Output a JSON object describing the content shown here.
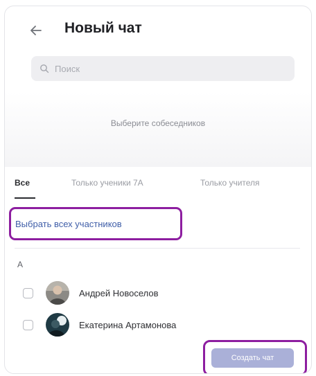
{
  "header": {
    "title": "Новый чат",
    "back_icon": "arrow-left-icon"
  },
  "search": {
    "placeholder": "Поиск",
    "value": "",
    "icon": "search-icon"
  },
  "selected": {
    "hint": "Выберите собеседников"
  },
  "tabs": [
    {
      "label": "Все",
      "active": true
    },
    {
      "label": "Только ученики 7А",
      "active": false
    },
    {
      "label": "Только учителя",
      "active": false
    }
  ],
  "select_all_label": "Выбрать всех участников",
  "contacts": {
    "section_letter": "А",
    "items": [
      {
        "name": "Андрей Новоселов",
        "checked": false
      },
      {
        "name": "Екатерина Артамонова",
        "checked": false
      }
    ]
  },
  "create_button": {
    "label": "Создать чат"
  },
  "colors": {
    "highlight": "#8d1ea0",
    "primary_button_disabled": "#aab0d8",
    "link": "#3f5ea8"
  }
}
